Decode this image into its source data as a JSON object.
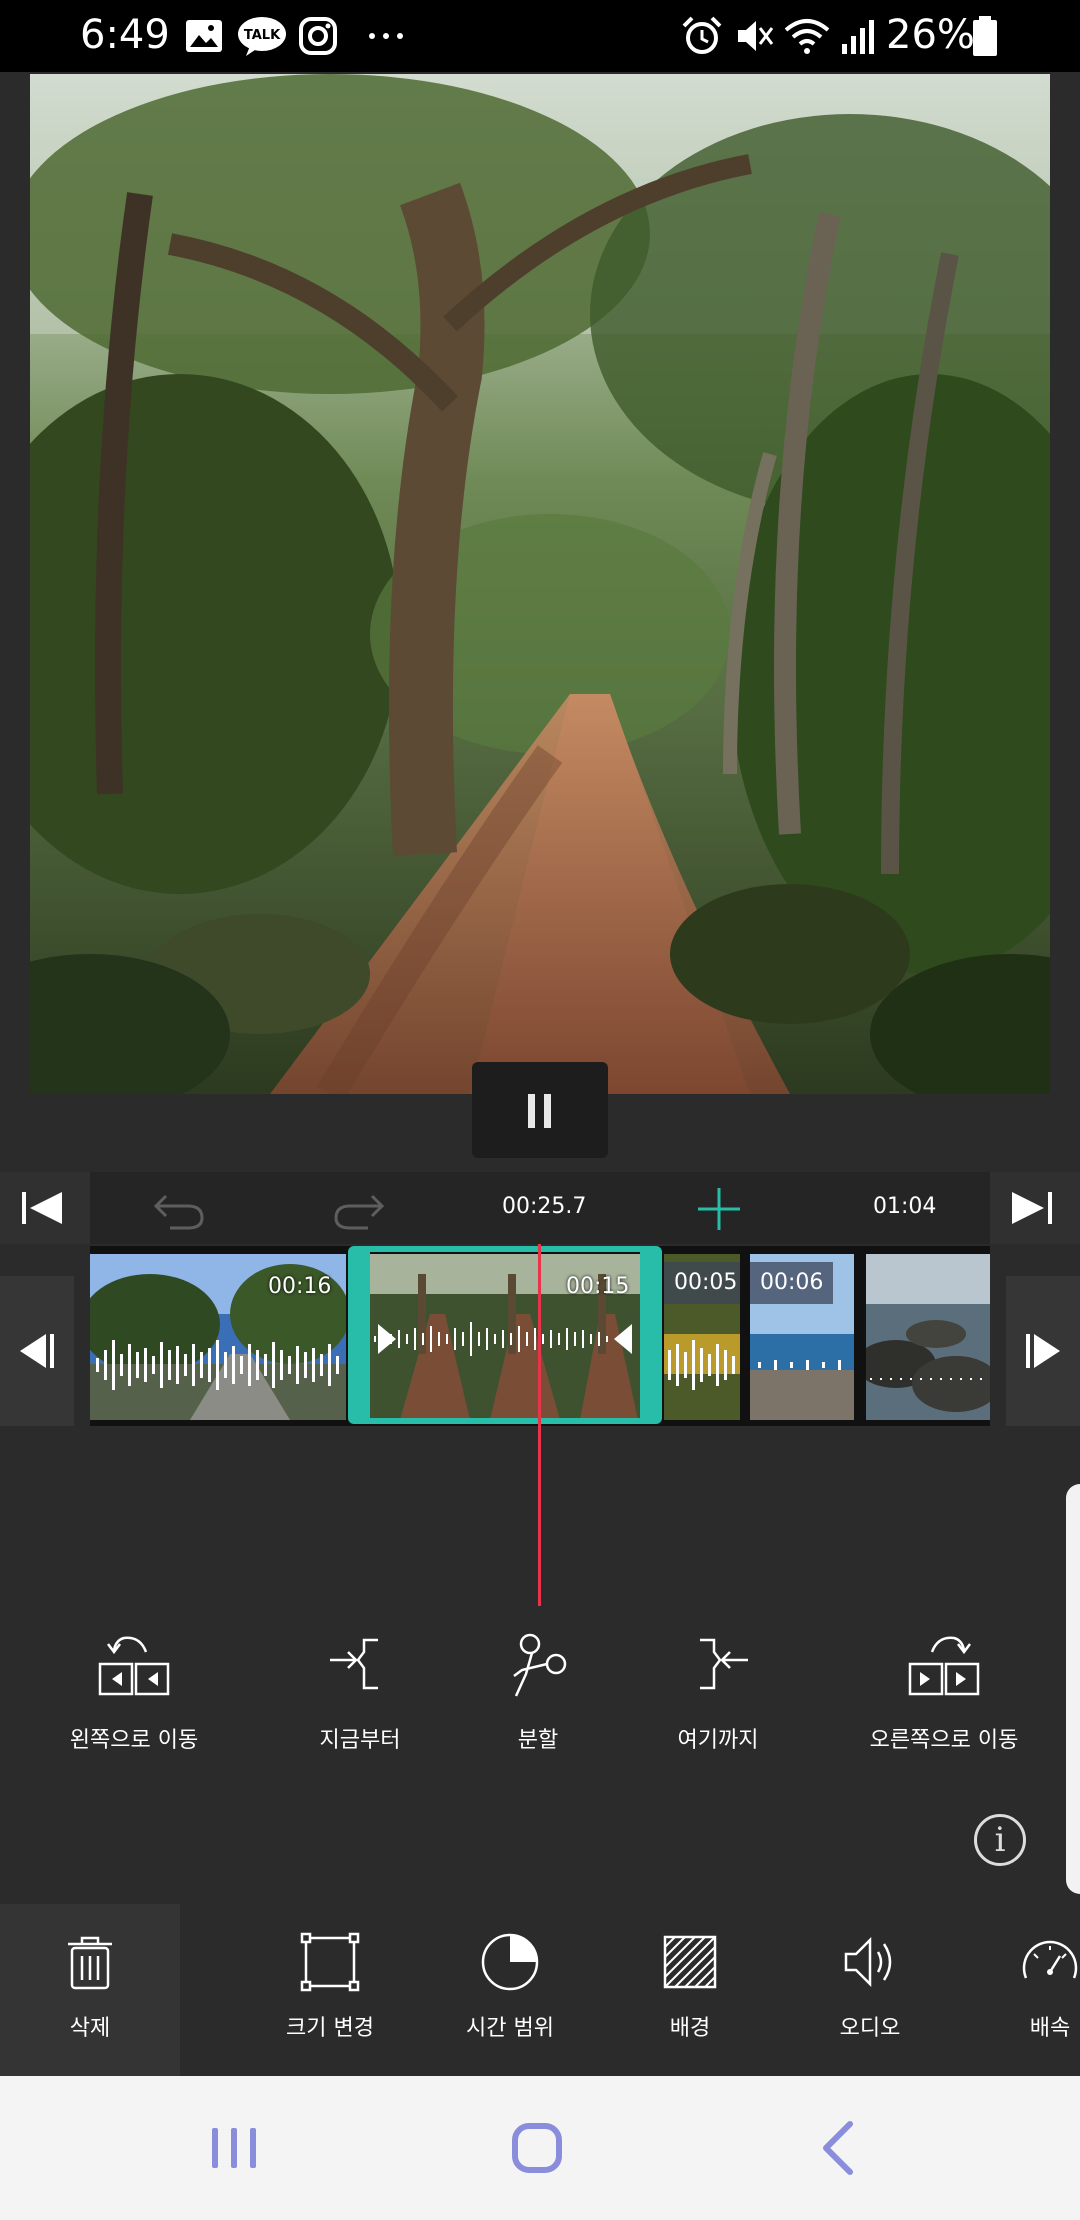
{
  "status_bar": {
    "time": "6:49",
    "battery": "26%",
    "left_icons": [
      "image-icon",
      "talk-icon",
      "instagram-icon",
      "more-icon"
    ],
    "right_icons": [
      "alarm-icon",
      "mute-icon",
      "wifi-icon",
      "signal-icon",
      "battery-icon"
    ],
    "talk_text": "TALK"
  },
  "timeline": {
    "current_time": "00:25.7",
    "total_time": "01:04",
    "clips": [
      {
        "duration": "00:16"
      },
      {
        "duration": "00:15"
      },
      {
        "duration": "00:05"
      },
      {
        "duration": "00:06"
      },
      {
        "duration": ""
      }
    ]
  },
  "actions": [
    {
      "label": "왼쪽으로 이동",
      "icon": "move-left-icon"
    },
    {
      "label": "지금부터",
      "icon": "trim-start-icon"
    },
    {
      "label": "분할",
      "icon": "scissors-icon"
    },
    {
      "label": "여기까지",
      "icon": "trim-end-icon"
    },
    {
      "label": "오른쪽으로 이동",
      "icon": "move-right-icon"
    }
  ],
  "tools": [
    {
      "label": "삭제",
      "icon": "trash-icon",
      "selected": true
    },
    {
      "label": "크기 변경",
      "icon": "resize-icon"
    },
    {
      "label": "시간 범위",
      "icon": "time-range-icon"
    },
    {
      "label": "배경",
      "icon": "background-icon"
    },
    {
      "label": "오디오",
      "icon": "audio-icon"
    },
    {
      "label": "배속",
      "icon": "speed-icon"
    }
  ],
  "colors": {
    "accent": "#27bda8",
    "playhead": "#e8334a",
    "background": "#2b2b2b",
    "nav_icon": "#8a8ddb"
  }
}
